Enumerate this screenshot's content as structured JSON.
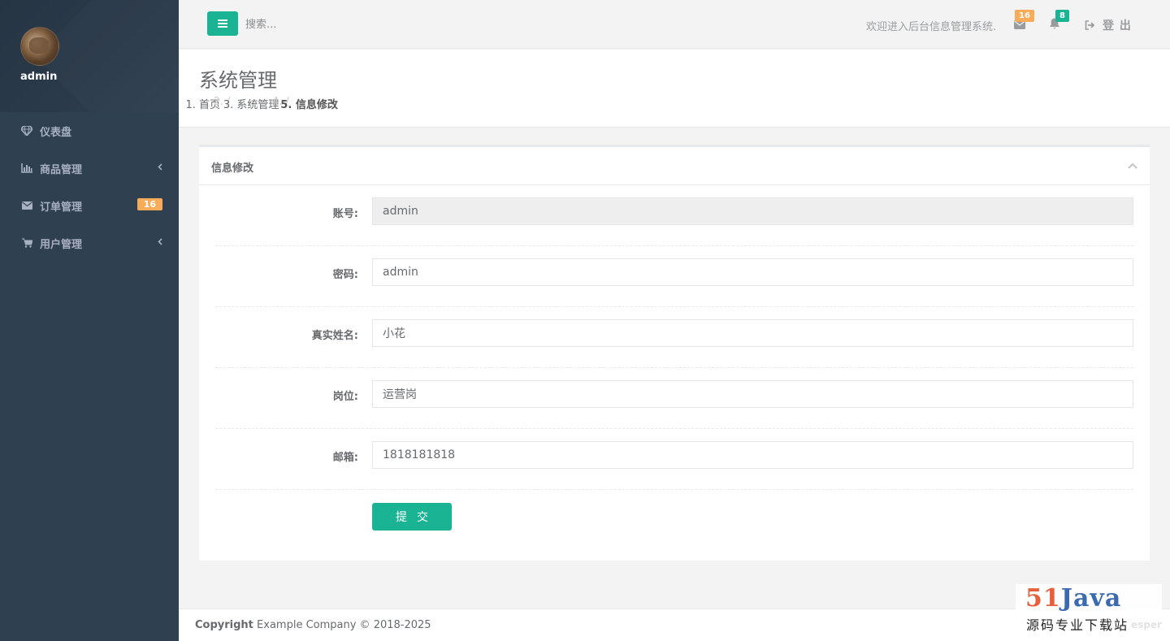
{
  "sidebar": {
    "profile_name": "admin",
    "items": [
      {
        "label": "仪表盘",
        "icon": "diamond-icon"
      },
      {
        "label": "商品管理",
        "icon": "bar-chart-icon",
        "has_children": true
      },
      {
        "label": "订单管理",
        "icon": "envelope-icon",
        "badge": "16"
      },
      {
        "label": "用户管理",
        "icon": "shopping-cart-icon",
        "has_children": true
      }
    ]
  },
  "topbar": {
    "search_placeholder": "搜索...",
    "welcome": "欢迎进入后台信息管理系统.",
    "mail_count": "16",
    "alert_count": "8",
    "logout_label": "登 出"
  },
  "heading": {
    "title": "系统管理",
    "breadcrumb": [
      "首页",
      "系统管理",
      "信息修改"
    ]
  },
  "panel": {
    "title": "信息修改",
    "fields": [
      {
        "label": "账号:",
        "value": "admin",
        "disabled": true
      },
      {
        "label": "密码:",
        "value": "admin"
      },
      {
        "label": "真实姓名:",
        "value": "小花"
      },
      {
        "label": "岗位:",
        "value": "运营岗"
      },
      {
        "label": "邮箱:",
        "value": "1818181818"
      }
    ],
    "submit_label": "提交"
  },
  "footer": {
    "copyright_label": "Copyright",
    "copyright_text": "Example Company © 2018-2025"
  },
  "watermark": {
    "num": "51",
    "word": "Java",
    "subtitle": "源码专业下载站",
    "ghost": "esper"
  },
  "colors": {
    "sidebar_bg": "#2f4050",
    "accent_green": "#1ab394",
    "badge_orange": "#f8ac59"
  }
}
